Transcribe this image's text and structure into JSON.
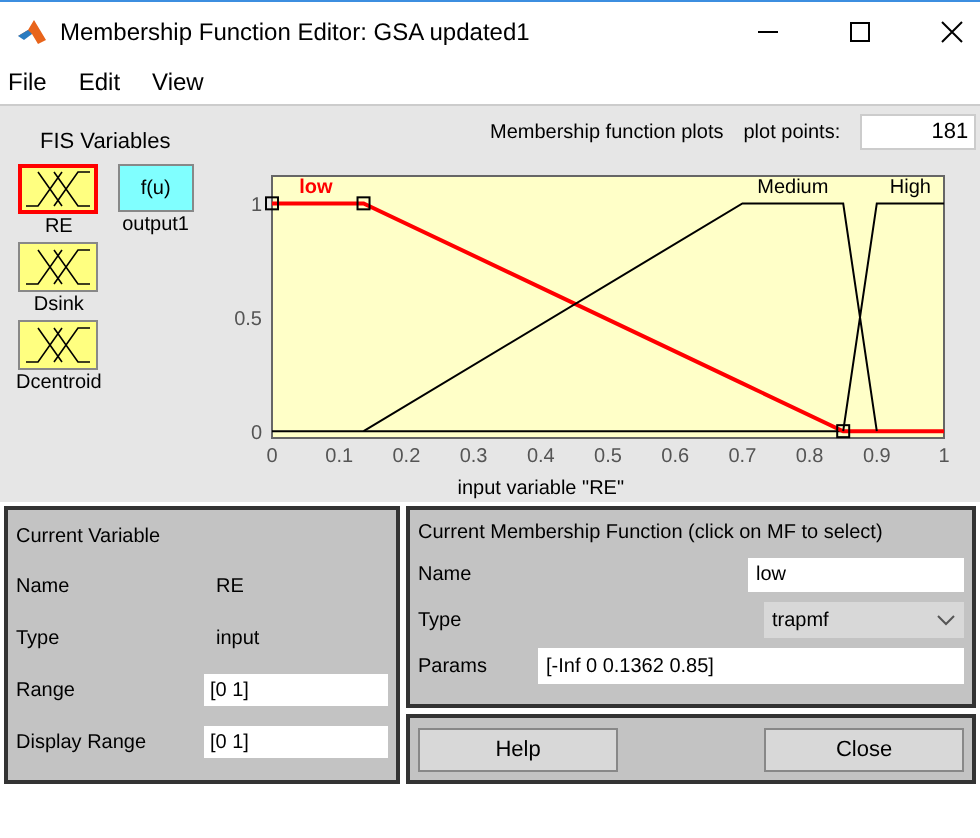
{
  "window": {
    "title": "Membership Function Editor: GSA updated1"
  },
  "menu": [
    "File",
    "Edit",
    "View"
  ],
  "fis_variables": {
    "title": "FIS Variables",
    "items": [
      {
        "label": "RE",
        "kind": "input",
        "selected": true
      },
      {
        "label": "Dsink",
        "kind": "input",
        "selected": false
      },
      {
        "label": "Dcentroid",
        "kind": "input",
        "selected": false
      },
      {
        "label": "output1",
        "kind": "output",
        "selected": false,
        "symbol": "f(u)"
      }
    ]
  },
  "plot": {
    "mf_labels": [
      {
        "text": "low",
        "selected": true
      },
      {
        "text": "Medium",
        "selected": false
      },
      {
        "text": "High",
        "selected": false
      }
    ],
    "title": "Membership function plots",
    "plot_points_label": "plot points:",
    "plot_points": "181",
    "chart_data": {
      "type": "line",
      "xlabel": "input variable \"RE\"",
      "x": [
        0,
        0.1362,
        0.7,
        0.85,
        0.9,
        1
      ],
      "series": [
        {
          "color": "#ff0000",
          "values": [
            1,
            1,
            0.21,
            0,
            0,
            0
          ]
        },
        {
          "color": "#000000",
          "values": [
            null,
            0,
            1,
            1,
            0,
            null
          ]
        },
        {
          "color": "#000000",
          "values": [
            null,
            null,
            null,
            0,
            1,
            1
          ]
        }
      ],
      "xlim": [
        0,
        1
      ],
      "ylim": [
        -0.03,
        1.12
      ],
      "xticks": [
        0,
        0.1,
        0.2,
        0.3,
        0.4,
        0.5,
        0.6,
        0.7,
        0.8,
        0.9,
        1
      ],
      "yticks": [
        0,
        0.5,
        1
      ]
    }
  },
  "current_variable": {
    "title": "Current Variable",
    "fields": [
      {
        "label": "Name",
        "value": "RE",
        "kind": "text"
      },
      {
        "label": "Type",
        "value": "input",
        "kind": "text"
      },
      {
        "label": "Range",
        "value": "[0 1]",
        "kind": "input"
      },
      {
        "label": "Display Range",
        "value": "[0 1]",
        "kind": "input"
      }
    ]
  },
  "current_mf": {
    "title": "Current Membership Function (click on MF to select)",
    "fields": [
      {
        "label": "Name",
        "value": "low",
        "kind": "input"
      },
      {
        "label": "Type",
        "value": "trapmf",
        "kind": "dropdown"
      },
      {
        "label": "Params",
        "value": "[-Inf 0 0.1362 0.85]",
        "kind": "wide"
      }
    ]
  },
  "buttons": [
    "Help",
    "Close"
  ]
}
